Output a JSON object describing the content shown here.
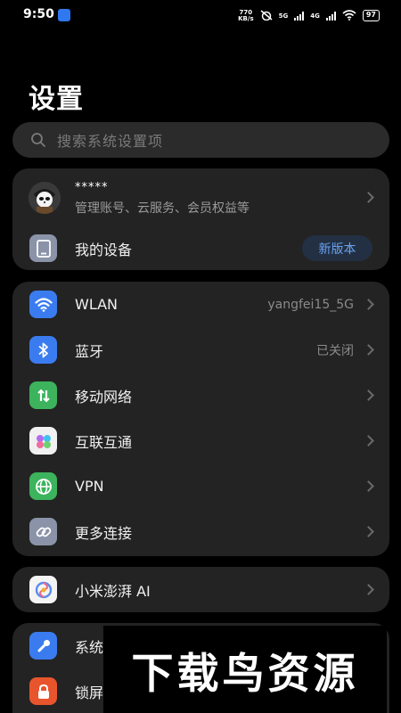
{
  "status_bar": {
    "time": "9:50",
    "net_speed_value": "770",
    "net_speed_unit": "KB/s",
    "sim1_type": "5G",
    "sim2_type": "4G",
    "battery": "97"
  },
  "page": {
    "title": "设置"
  },
  "search": {
    "placeholder": "搜索系统设置项"
  },
  "account": {
    "name": "*****",
    "subtitle": "管理账号、云服务、会员权益等",
    "device_label": "我的设备",
    "device_badge": "新版本"
  },
  "connections": {
    "items": [
      {
        "label": "WLAN",
        "value": "yangfei15_5G",
        "icon": "wifi-icon",
        "color": "#3a7cf0"
      },
      {
        "label": "蓝牙",
        "value": "已关闭",
        "icon": "bluetooth-icon",
        "color": "#3a7cf0"
      },
      {
        "label": "移动网络",
        "value": "",
        "icon": "mobile-network-icon",
        "color": "#3cb35c"
      },
      {
        "label": "互联互通",
        "value": "",
        "icon": "interconnect-icon",
        "color": "#f0f0f0"
      },
      {
        "label": "VPN",
        "value": "",
        "icon": "vpn-globe-icon",
        "color": "#3cb35c"
      },
      {
        "label": "更多连接",
        "value": "",
        "icon": "link-icon",
        "color": "#8a93a8"
      }
    ]
  },
  "ai": {
    "label": "小米澎湃 AI",
    "icon": "ai-swirl-icon"
  },
  "system": {
    "items": [
      {
        "label": "系统",
        "icon": "wrench-icon",
        "color": "#3a7cf0"
      },
      {
        "label": "锁屏",
        "icon": "lock-icon",
        "color": "#e8552c"
      }
    ]
  },
  "watermark": {
    "text": "下载鸟资源"
  }
}
